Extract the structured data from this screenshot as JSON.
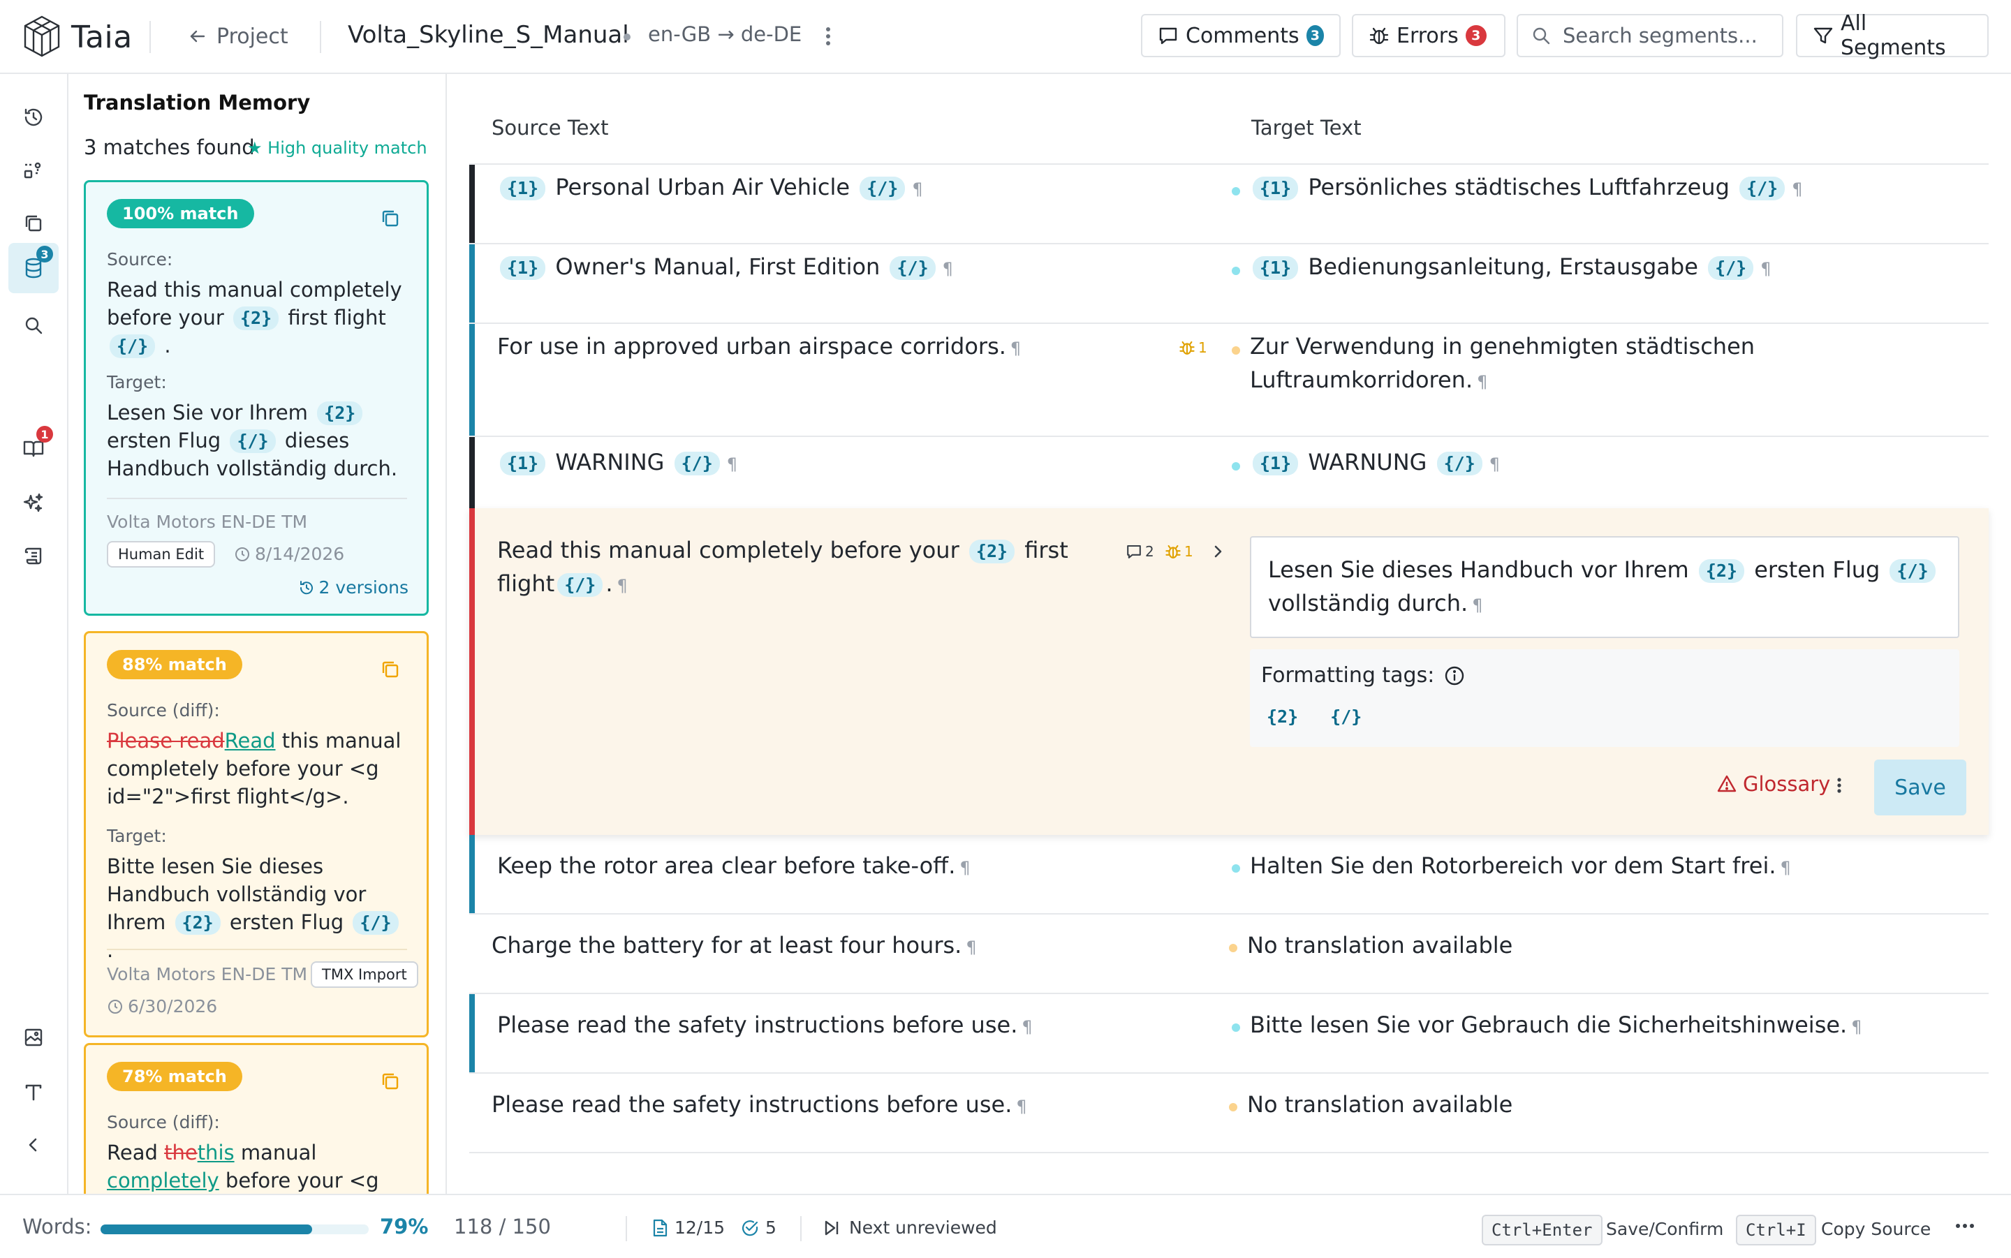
{
  "app": {
    "name": "Taia"
  },
  "header": {
    "back_label": "Project",
    "project_title": "Volta_Skyline_S_Manual",
    "language_pair": "en-GB → de-DE",
    "comments_label": "Comments",
    "comments_count": "3",
    "errors_label": "Errors",
    "errors_count": "3",
    "search_placeholder": "Search segments...",
    "filter_label": "All Segments",
    "colors": {
      "comments_badge": "#1b84a8",
      "errors_badge": "#d9383e"
    }
  },
  "rail": {
    "items": [
      "history-icon",
      "workflow-icon",
      "copy-icon",
      "database-icon",
      "search-icon",
      "book-icon",
      "sparkle-icon",
      "scroll-icon"
    ],
    "bottom_items": [
      "image-icon",
      "text-icon",
      "collapse-icon"
    ],
    "badges": {
      "database": "3",
      "book": "1"
    }
  },
  "tm": {
    "title": "Translation Memory",
    "count_text": "3 matches found",
    "high_quality": "★ High quality match",
    "cards": [
      {
        "percent": "100% match",
        "source_label": "Source:",
        "source_pre": "Read this manual completely before your",
        "source_tag": "{2}",
        "source_mid": "first flight",
        "source_tag2": "{/}",
        "source_end": ".",
        "target_label": "Target:",
        "target_pre": "Lesen Sie vor Ihrem",
        "target_tag": "{2}",
        "target_mid": "ersten Flug",
        "target_tag2": "{/}",
        "target_end": "dieses Handbuch vollständig durch.",
        "tm_name": "Volta Motors EN-DE TM",
        "chip": "Human Edit",
        "date": "8/14/2026",
        "versions": "2 versions"
      },
      {
        "percent": "88% match",
        "source_label": "Source (diff):",
        "del": "Please read",
        "ins": "Read",
        "source_rest": "this manual completely before your <g id=\"2\">first flight</g>.",
        "target_label": "Target:",
        "target_pre": "Bitte lesen Sie dieses Handbuch vollständig vor Ihrem",
        "target_tag": "{2}",
        "target_mid": "ersten Flug",
        "target_tag2": "{/}",
        "target_end": ".",
        "tm_name": "Volta Motors EN-DE TM",
        "chip": "TMX Import",
        "date": "6/30/2026"
      },
      {
        "percent": "78% match",
        "source_label": "Source (diff):",
        "pre": "Read",
        "del": "the",
        "ins": "this",
        "mid": "manual",
        "ins2": "completely",
        "rest": "before your <g"
      }
    ]
  },
  "editor": {
    "source_header": "Source Text",
    "target_header": "Target Text",
    "segments": [
      {
        "src": "Personal Urban Air Vehicle",
        "tgt": "Persönliches städtisches Luftfahrzeug"
      },
      {
        "src": "Owner's Manual, First Edition",
        "tgt": "Bedienungsanleitung, Erstausgabe"
      },
      {
        "src_line1": "For use in approved urban airspace corridors.",
        "err_count": "1",
        "tgt_line1": "Zur Verwendung in genehmigten städtischen",
        "tgt_line2": "Luftraumkorridoren."
      },
      {
        "src": "WARNING",
        "tgt": "WARNUNG"
      },
      {
        "src_line1": "Read this manual completely before your",
        "src_tag": "{2}",
        "src_mid": "first",
        "src_line2": "flight",
        "src_tag2": "{/}",
        "comment_count": "2",
        "err_count": "1",
        "tgt_pre": "Lesen Sie dieses Handbuch vor Ihrem",
        "tgt_tag": "{2}",
        "tgt_mid": "ersten Flug",
        "tgt_tag2": "{/}",
        "tgt_line2": "vollständig durch.",
        "formatting_label": "Formatting tags:",
        "fmt_tags": [
          "{2}",
          "{/}"
        ],
        "glossary_label": "Glossary",
        "save_label": "Save"
      },
      {
        "src": "Keep the rotor area clear before take-off.",
        "tgt": "Halten Sie den Rotorbereich vor dem Start frei."
      },
      {
        "src": "Charge the battery for at least four hours.",
        "tgt": "No translation available"
      },
      {
        "src": "Please read the safety instructions before use.",
        "tgt": "Bitte lesen Sie vor Gebrauch die Sicherheitshinweise."
      },
      {
        "src": "Please read the safety instructions before use.",
        "tgt": "No translation available"
      }
    ],
    "tag_open": "{1}",
    "tag_close": "{/}",
    "colors": {
      "bar_dark": "#1f2329",
      "bar_blue": "#1b84a8",
      "bar_red": "#d9383e",
      "dot_cyan": "#8ee3ee",
      "dot_amber": "#fbd38d"
    }
  },
  "footer": {
    "words_label": "Words:",
    "progress_percent": "79%",
    "progress_value": 0.79,
    "word_count": "118 / 150",
    "segments_count": "12/15",
    "confirmed_count": "5",
    "next_label": "Next unreviewed",
    "shortcut1_key": "Ctrl+Enter",
    "shortcut1_label": "Save/Confirm",
    "shortcut2_key": "Ctrl+I",
    "shortcut2_label": "Copy Source"
  }
}
